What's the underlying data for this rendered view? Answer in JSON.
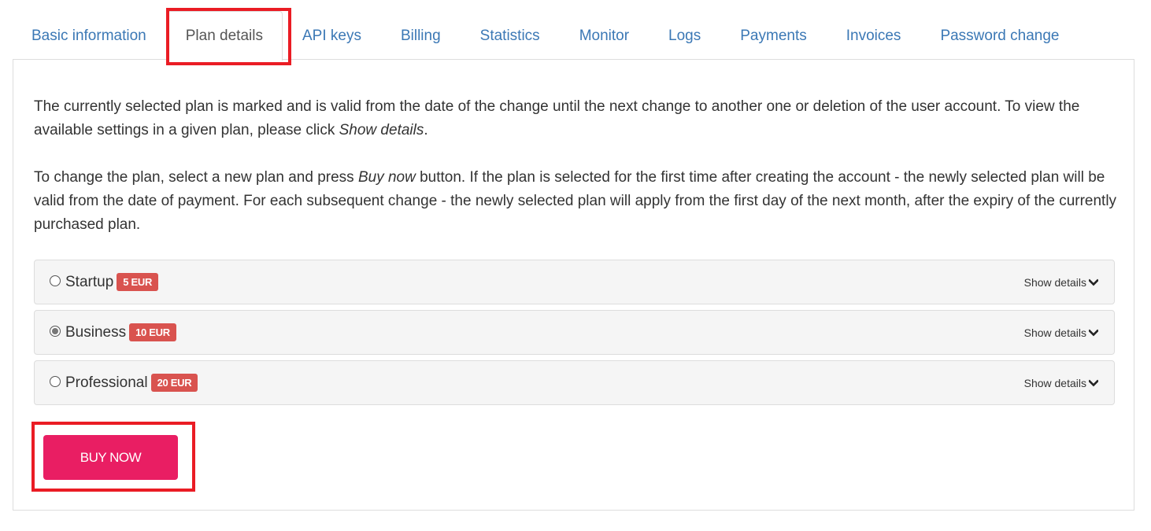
{
  "tabs": [
    {
      "label": "Basic information",
      "active": false
    },
    {
      "label": "Plan details",
      "active": true
    },
    {
      "label": "API keys",
      "active": false
    },
    {
      "label": "Billing",
      "active": false
    },
    {
      "label": "Statistics",
      "active": false
    },
    {
      "label": "Monitor",
      "active": false
    },
    {
      "label": "Logs",
      "active": false
    },
    {
      "label": "Payments",
      "active": false
    },
    {
      "label": "Invoices",
      "active": false
    },
    {
      "label": "Password change",
      "active": false
    }
  ],
  "description": {
    "p1_text": "The currently selected plan is marked and is valid from the date of the change until the next change to another one or deletion of the user account. To view the available settings in a given plan, please click ",
    "p1_em": "Show details",
    "p1_end": ".",
    "p2_text": "To change the plan, select a new plan and press ",
    "p2_em": "Buy now",
    "p2_end": " button. If the plan is selected for the first time after creating the account - the newly selected plan will be valid from the date of payment. For each subsequent change - the newly selected plan will apply from the first day of the next month, after the expiry of the currently purchased plan."
  },
  "plans": [
    {
      "name": "Startup",
      "price": "5 EUR",
      "selected": false,
      "details_label": "Show details"
    },
    {
      "name": "Business",
      "price": "10 EUR",
      "selected": true,
      "details_label": "Show details"
    },
    {
      "name": "Professional",
      "price": "20 EUR",
      "selected": false,
      "details_label": "Show details"
    }
  ],
  "buy_button": {
    "label": "BUY NOW"
  },
  "colors": {
    "tab_link": "#3b78b5",
    "price_badge": "#d9534f",
    "buy_button": "#e91e63",
    "highlight": "#ea1c24"
  }
}
